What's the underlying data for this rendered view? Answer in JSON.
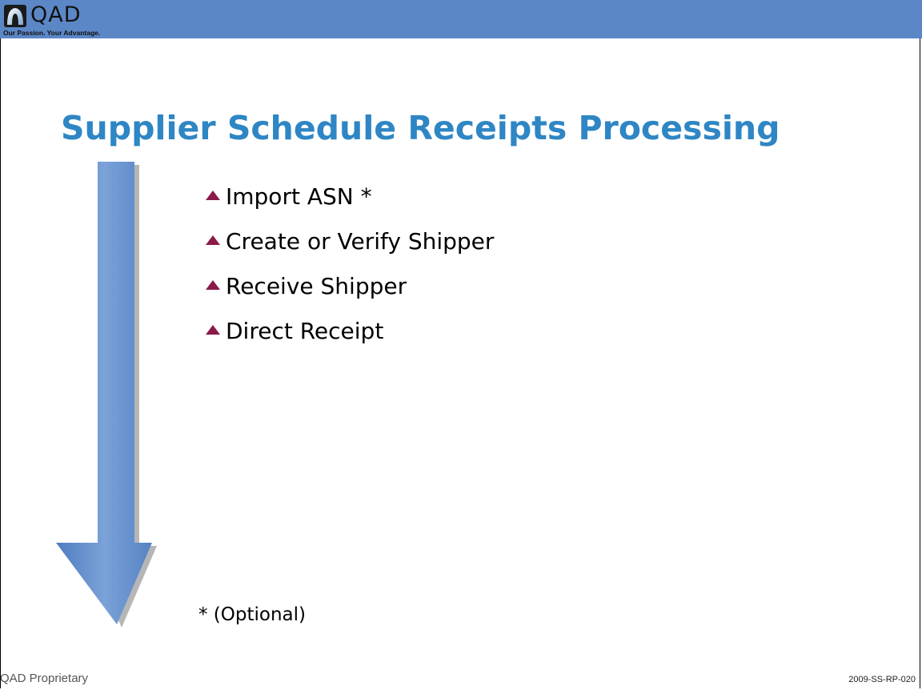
{
  "header": {
    "logo_text": "QAD",
    "logo_tagline": "Our Passion. Your Advantage.",
    "bar_color": "#5b87c7"
  },
  "slide": {
    "title": "Supplier Schedule Receipts Processing",
    "title_color": "#2e86c4",
    "bullet_color": "#8b1a4a",
    "bullets": [
      {
        "label": "Import ASN *"
      },
      {
        "label": "Create or Verify Shipper"
      },
      {
        "label": "Receive Shipper"
      },
      {
        "label": "Direct Receipt"
      }
    ],
    "footnote": "* (Optional)",
    "arrow_icon": "down-arrow-icon",
    "arrow_color": "#6b8fc8"
  },
  "footer": {
    "left": "QAD Proprietary",
    "right": "2009-SS-RP-020"
  }
}
